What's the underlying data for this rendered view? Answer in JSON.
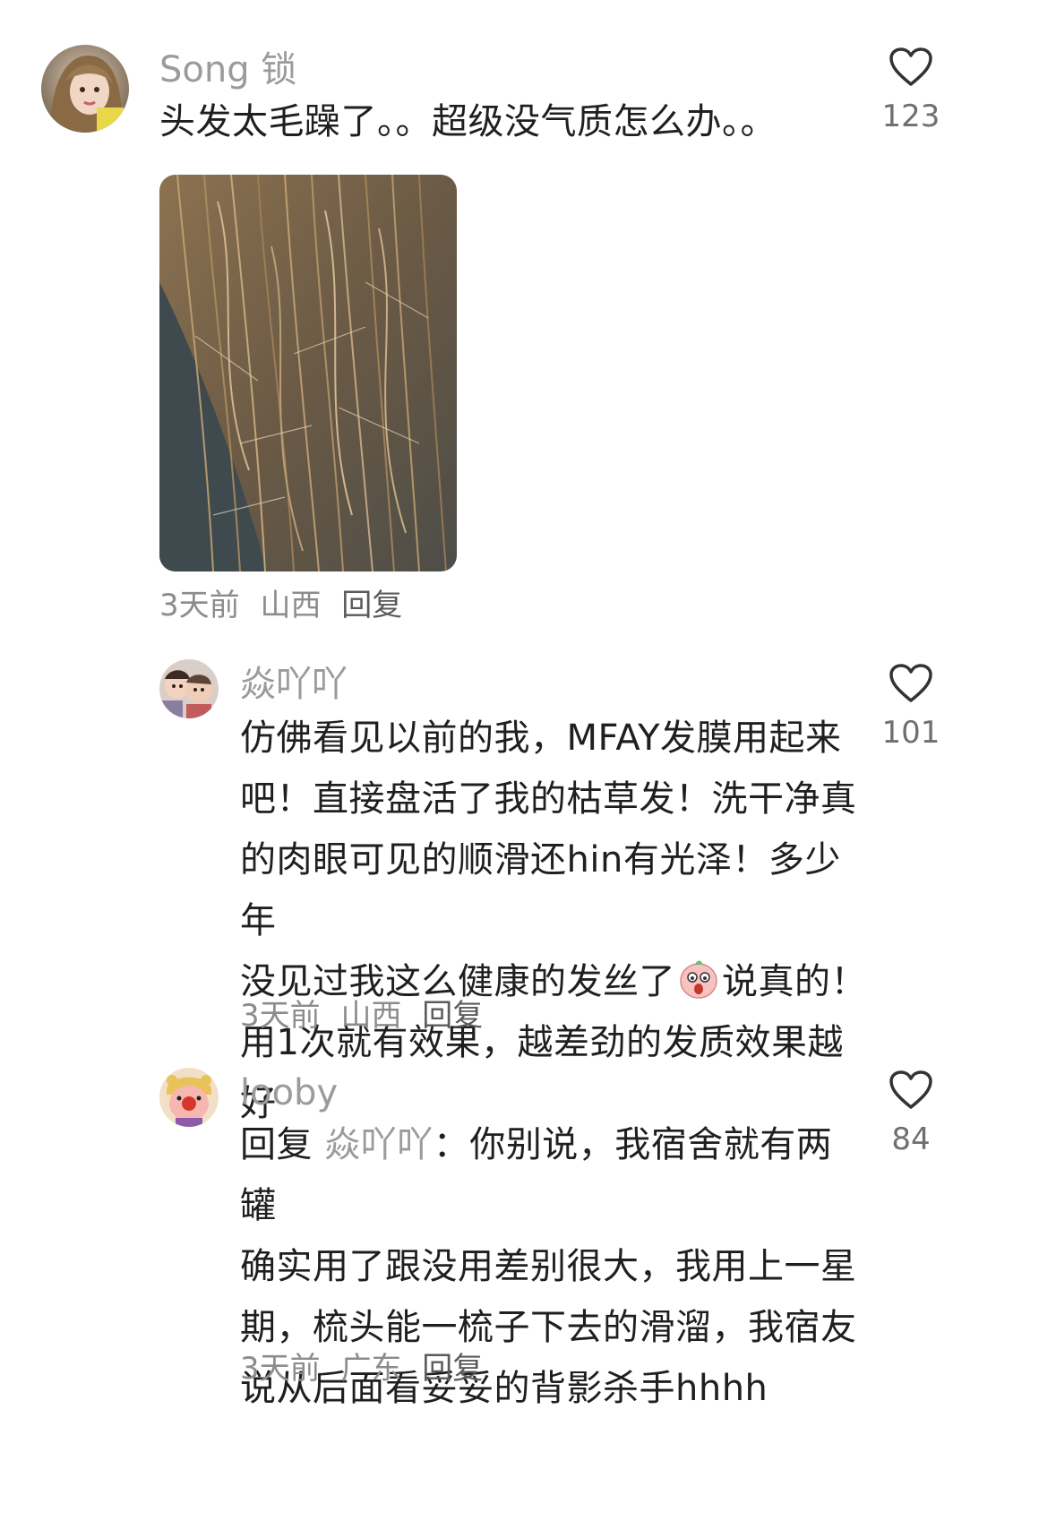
{
  "comments": [
    {
      "username": "Song 锁",
      "text": "头发太毛躁了。。超级没气质怎么办。。",
      "likes": "123",
      "time": "3天前",
      "location": "山西",
      "reply_label": "回复"
    },
    {
      "username": "焱吖吖",
      "lines": [
        "仿佛看见以前的我，MFAY发膜用起来",
        "吧！直接盘活了我的枯草发！洗干净真",
        "的肉眼可见的顺滑还hin有光泽！多少年",
        "没见过我这么健康的发丝了",
        "说真的！",
        "用1次就有效果，越差劲的发质效果越好"
      ],
      "likes": "101",
      "time": "3天前",
      "location": "山西",
      "reply_label": "回复"
    },
    {
      "username": "looby",
      "reply_prefix": "回复",
      "reply_to": "焱吖吖",
      "reply_colon": "：",
      "lines": [
        "你别说，我宿舍就有两罐",
        "确实用了跟没用差别很大，我用上一星",
        "期，梳头能一梳子下去的滑溜，我宿友",
        "说从后面看妥妥的背影杀手hhhh"
      ],
      "likes": "84",
      "time": "3天前",
      "location": "广东",
      "reply_label": "回复"
    }
  ],
  "icons": {
    "like": "heart-outline-icon",
    "emoji": "shocked-face-emoji-icon"
  },
  "colors": {
    "username": "#9b9b9b",
    "text": "#1f1f1f",
    "meta": "#8c8c8c"
  }
}
